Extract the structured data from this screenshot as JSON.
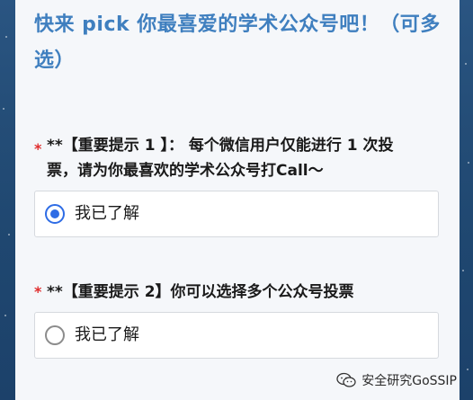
{
  "survey": {
    "title": "快来 pick 你最喜爱的学术公众号吧！（可多选）"
  },
  "questions": [
    {
      "required_mark": "*",
      "text_line1": "**【重要提示 1 】：  每个微信用户仅能进行 1 次投",
      "text_line2": "票，请为你最喜欢的学术公众号打Call～",
      "options": [
        {
          "label": "我已了解",
          "selected": true
        }
      ]
    },
    {
      "required_mark": "*",
      "text_line1": "**【重要提示 2】你可以选择多个公众号投票",
      "options": [
        {
          "label": "我已了解",
          "selected": false
        }
      ]
    }
  ],
  "watermark": {
    "icon": "wechat-icon",
    "text": "安全研究GoSSIP"
  },
  "colors": {
    "title": "#3f7fbf",
    "required": "#e02d2d",
    "radio_selected": "#2e6ce5",
    "background": "#234b75",
    "card": "#f5f7fa"
  }
}
